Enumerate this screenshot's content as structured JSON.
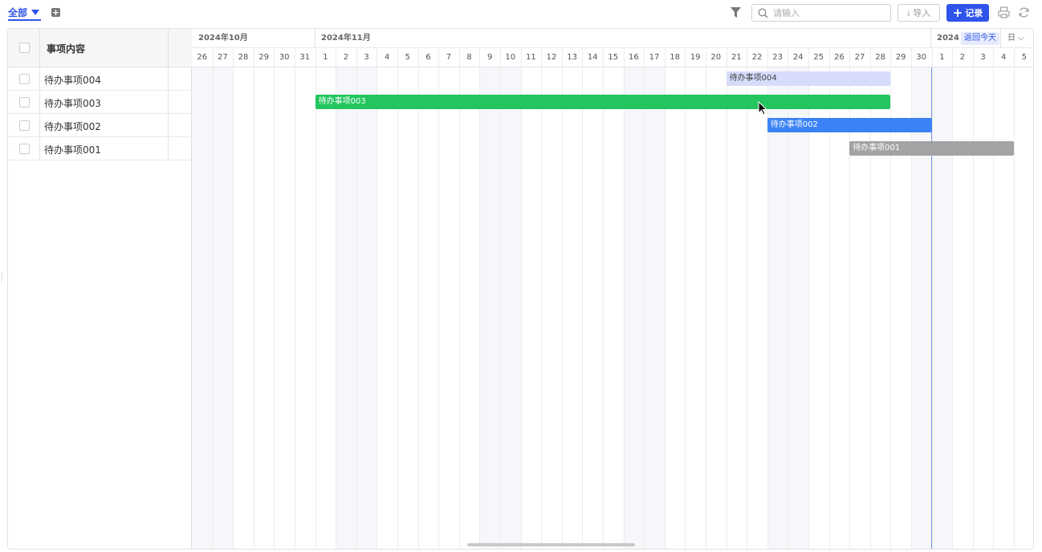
{
  "toolbar": {
    "view_label": "全部",
    "add_view": "+",
    "search_placeholder": "请输入",
    "import_label": "导入",
    "record_label": "记录",
    "record_plus": "+"
  },
  "table": {
    "header": "事项内容",
    "rows": [
      {
        "name": "待办事项004"
      },
      {
        "name": "待办事项003"
      },
      {
        "name": "待办事项002"
      },
      {
        "name": "待办事项001"
      }
    ]
  },
  "timeline": {
    "months": [
      "2024年10月",
      "2024年11月",
      "2024"
    ],
    "today_label": "返回今天",
    "unit_label": "日 ⌵",
    "oct_days": [
      "26",
      "27",
      "28",
      "29",
      "30",
      "31"
    ],
    "nov_days": [
      "1",
      "2",
      "3",
      "4",
      "5",
      "6",
      "7",
      "8",
      "9",
      "10",
      "11",
      "12",
      "13",
      "14",
      "15",
      "16",
      "17",
      "18",
      "19",
      "20",
      "21",
      "22",
      "23",
      "24",
      "25",
      "26",
      "27",
      "28",
      "29",
      "30"
    ],
    "dec_days": [
      "1",
      "2",
      "3",
      "4",
      "5"
    ],
    "today": "2024-12-01"
  },
  "bars": [
    {
      "label": "待办事项004",
      "start": "2024-11-21",
      "end": "2024-11-29",
      "color": "#d6dcfa",
      "text_color": "#444"
    },
    {
      "label": "待办事项003",
      "start": "2024-11-01",
      "end": "2024-11-29",
      "color": "#22c55e",
      "text_color": "#ffffff"
    },
    {
      "label": "待办事项002",
      "start": "2024-11-23",
      "end": "2024-12-01",
      "color": "#3b82f6",
      "text_color": "#ffffff"
    },
    {
      "label": "待办事项001",
      "start": "2024-11-27",
      "end": "2024-12-05",
      "color": "#a3a3a3",
      "text_color": "#ffffff"
    }
  ],
  "colors": {
    "accent": "#2f54eb",
    "weekend": "#f6f7fa",
    "today_line": "#7b93ee"
  }
}
